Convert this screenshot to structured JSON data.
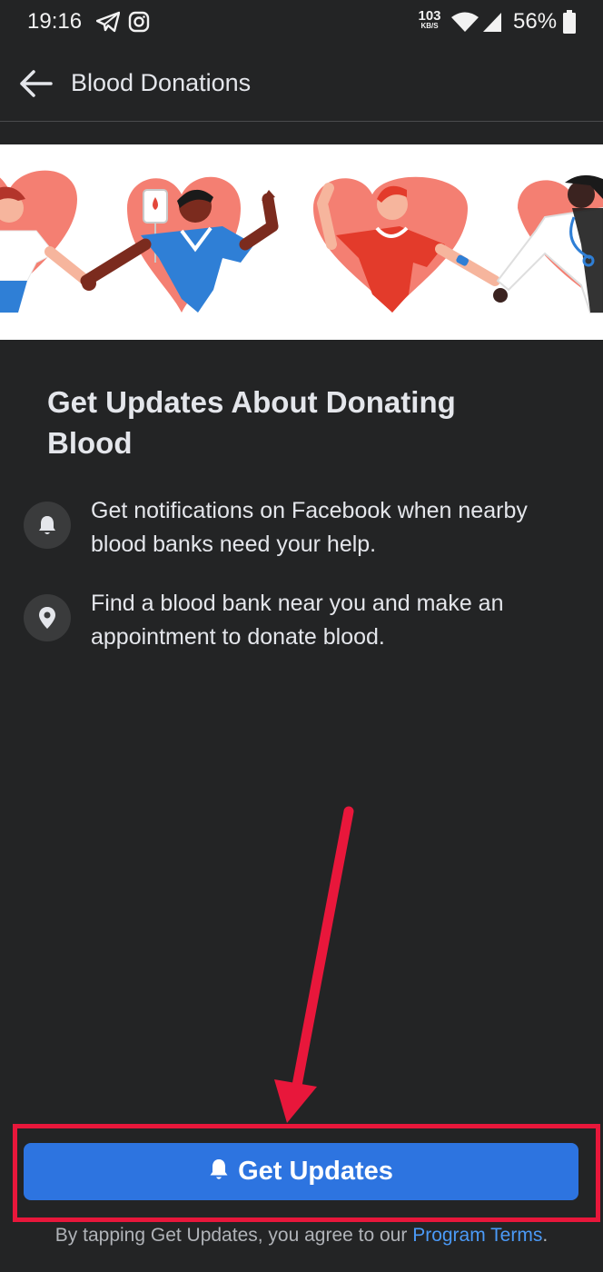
{
  "status_bar": {
    "time": "19:16",
    "net_speed_value": "103",
    "net_speed_unit": "KB/S",
    "battery": "56%",
    "icons": [
      "telegram-icon",
      "instagram-icon",
      "wifi-icon",
      "signal-icon",
      "battery-icon"
    ]
  },
  "header": {
    "title": "Blood Donations"
  },
  "main": {
    "headline": "Get Updates About Donating Blood",
    "features": [
      {
        "icon": "bell-icon",
        "text": "Get notifications on Facebook when nearby blood banks need your help."
      },
      {
        "icon": "location-pin-icon",
        "text": "Find a blood bank near you and make an appointment to donate blood."
      }
    ]
  },
  "cta": {
    "label": "Get Updates",
    "icon": "bell-icon"
  },
  "terms": {
    "prefix": "By tapping Get Updates, you agree to our ",
    "link": "Program Terms",
    "suffix": "."
  },
  "colors": {
    "background": "#232425",
    "primary_button": "#2d74e0",
    "link": "#4b9af7",
    "annotation": "#e8173b",
    "heart": "#f47f72"
  }
}
